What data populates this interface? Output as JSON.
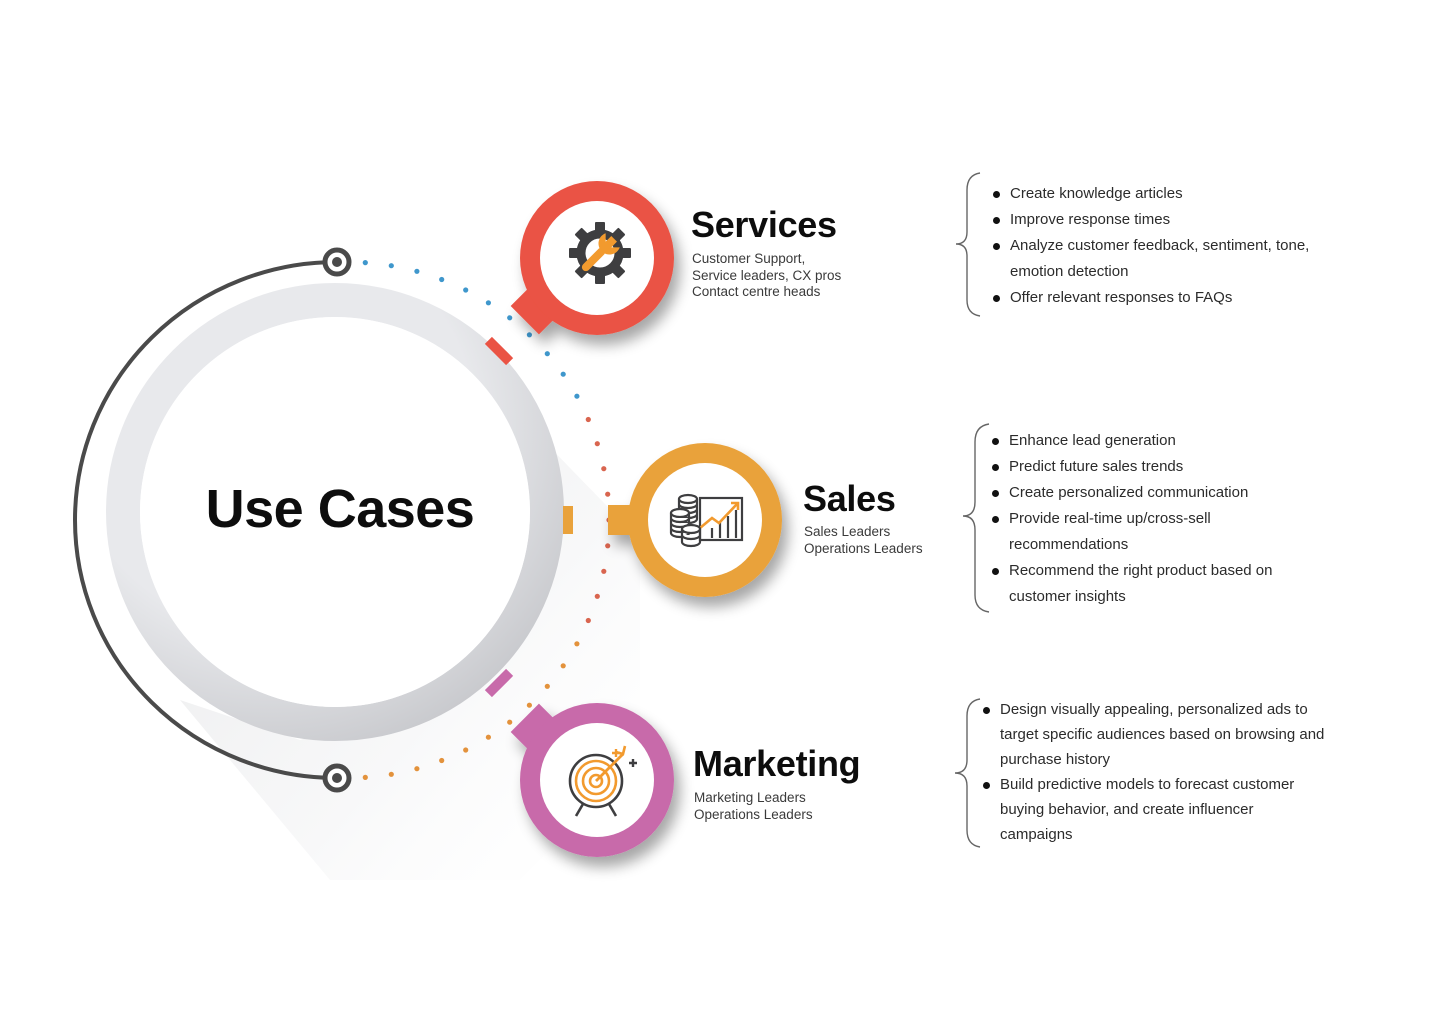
{
  "hub": {
    "title": "Use Cases"
  },
  "colors": {
    "services": "#ea5344",
    "sales": "#e9a23b",
    "marketing": "#c86aaa",
    "dots_blue": "#3f97cc",
    "dots_red": "#d9654f",
    "dots_orange": "#e3923c",
    "arc": "#4a4a4a",
    "ring": "#e6e7ea",
    "icon_dark": "#3e3e40",
    "icon_accent": "#f29a2e"
  },
  "categories": [
    {
      "id": "services",
      "title": "Services",
      "icon": "gear-wrench-icon",
      "audiences": [
        "Customer Support,",
        "Service leaders, CX pros",
        "Contact centre heads"
      ],
      "bullets": [
        "Create knowledge articles",
        "Improve response times",
        "Analyze customer feedback, sentiment, tone, emotion detection",
        "Offer relevant responses to FAQs"
      ]
    },
    {
      "id": "sales",
      "title": "Sales",
      "icon": "coins-growth-chart-icon",
      "audiences": [
        "Sales Leaders",
        "Operations Leaders"
      ],
      "bullets": [
        "Enhance lead generation",
        "Predict future sales trends",
        "Create personalized communication",
        "Provide real-time up/cross-sell recommendations",
        "Recommend the right product based on customer insights"
      ]
    },
    {
      "id": "marketing",
      "title": "Marketing",
      "icon": "target-arrow-icon",
      "audiences": [
        "Marketing Leaders",
        "Operations Leaders"
      ],
      "bullets": [
        "Design visually appealing, personalized ads to target specific audiences based on browsing and purchase history",
        "Build predictive models to forecast customer buying behavior, and create influencer campaigns"
      ]
    }
  ]
}
